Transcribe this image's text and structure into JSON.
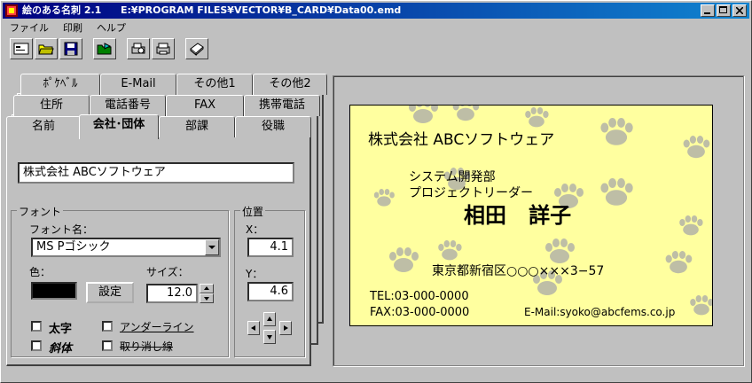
{
  "window": {
    "app_name": "絵のある名刺 2.1",
    "file_path": "E:¥PROGRAM FILES¥VECTOR¥B_CARD¥Data00.emd"
  },
  "menu": [
    "ファイル",
    "印刷",
    "ヘルプ"
  ],
  "toolbar": [
    {
      "icon": "new-card-icon"
    },
    {
      "icon": "open-folder-icon"
    },
    {
      "icon": "save-disk-icon"
    },
    {
      "icon": "import-icon"
    },
    {
      "icon": "print-preview-icon"
    },
    {
      "icon": "print-icon"
    },
    {
      "icon": "book-icon"
    }
  ],
  "tabs": {
    "row1": [
      "ﾎﾟｹﾍﾞﾙ",
      "E-Mail",
      "その他1",
      "その他2"
    ],
    "row2": [
      "住所",
      "電話番号",
      "FAX",
      "携帯電話"
    ],
    "row3": [
      "名前",
      "会社･団体",
      "部課",
      "役職"
    ],
    "active": "会社･団体"
  },
  "form": {
    "text_value": "株式会社  ABCソフトウェア",
    "font_group": "フォント",
    "font_name_label": "フォント名：",
    "font_name_value": "MS Pゴシック",
    "color_label": "色：",
    "color_value": "#000000",
    "size_label": "サイズ：",
    "size_value": "12.0",
    "set_button": "設定",
    "bold_label": "太字",
    "italic_label": "斜体",
    "underline_label": "アンダーライン",
    "strike_label": "取り消し線",
    "position_group": "位置",
    "x_label": "X：",
    "x_value": "4.1",
    "y_label": "Y：",
    "y_value": "4.6"
  },
  "card": {
    "company": "株式会社  ABCソフトウェア",
    "department": "システム開発部",
    "title": "プロジェクトリーダー",
    "name": "相田   詳子",
    "address": "東京都新宿区○○○×××3−57",
    "tel": "TEL:03-000-0000",
    "fax": "FAX:03-000-0000",
    "email": "E-Mail:syoko@abcfems.co.jp",
    "background": "#ffff9f",
    "paw_color": "#a8a8a8"
  }
}
